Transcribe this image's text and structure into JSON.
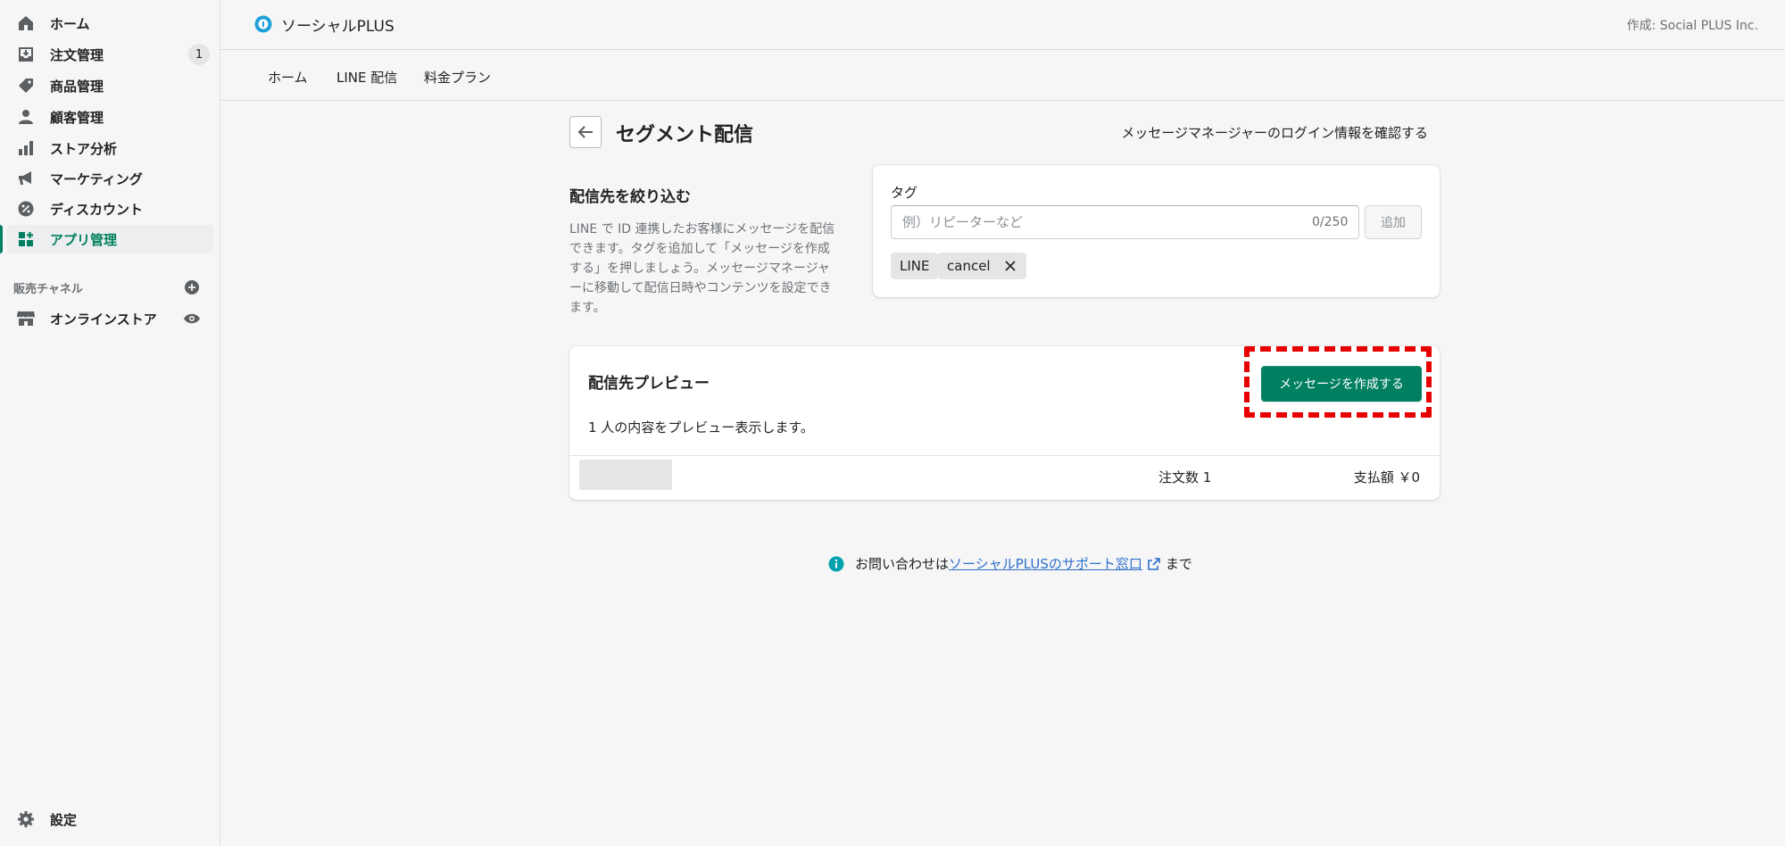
{
  "sidebar": {
    "items": [
      {
        "label": "ホーム",
        "icon": "home-icon"
      },
      {
        "label": "注文管理",
        "icon": "orders-icon",
        "badge": "1"
      },
      {
        "label": "商品管理",
        "icon": "tag-icon"
      },
      {
        "label": "顧客管理",
        "icon": "person-icon"
      },
      {
        "label": "ストア分析",
        "icon": "analytics-icon"
      },
      {
        "label": "マーケティング",
        "icon": "megaphone-icon"
      },
      {
        "label": "ディスカウント",
        "icon": "discount-icon"
      },
      {
        "label": "アプリ管理",
        "icon": "apps-icon",
        "active": true
      }
    ],
    "channels_title": "販売チャネル",
    "channels": [
      {
        "label": "オンラインストア",
        "icon": "store-icon"
      }
    ],
    "settings_label": "設定"
  },
  "topbar": {
    "app_name": "ソーシャルPLUS",
    "author": "作成: Social PLUS Inc."
  },
  "subnav": {
    "tabs": [
      "ホーム",
      "LINE 配信",
      "料金プラン"
    ]
  },
  "page": {
    "title": "セグメント配信",
    "login_link": "メッセージマネージャーのログイン情報を確認する"
  },
  "filter": {
    "heading": "配信先を絞り込む",
    "description": "LINE で ID 連携したお客様にメッセージを配信できます。タグを追加して「メッセージを作成する」を押しましょう。メッセージマネージャーに移動して配信日時やコンテンツを設定できます。",
    "tag_label": "タグ",
    "tag_placeholder": "例）リピーターなど",
    "tag_count": "0/250",
    "add_label": "追加",
    "chips": [
      "LINE",
      "cancel"
    ]
  },
  "preview": {
    "title": "配信先プレビュー",
    "create_label": "メッセージを作成する",
    "description": "1 人の内容をプレビュー表示します。",
    "order_count": "注文数 1",
    "paid_amount": "支払額 ￥0"
  },
  "footer": {
    "prefix": "お問い合わせは",
    "link": "ソーシャルPLUSのサポート窓口",
    "suffix": "まで"
  },
  "colors": {
    "accent": "#008060",
    "highlight": "#e80000",
    "link": "#2c6ecb"
  }
}
